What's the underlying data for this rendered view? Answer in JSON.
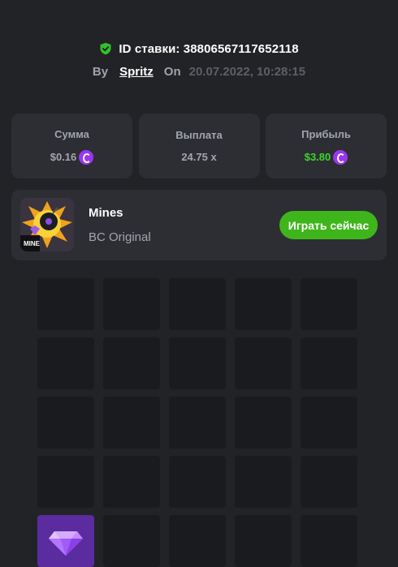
{
  "bet": {
    "id_text": "ID ставки: 3880656711765211​8",
    "by_label": "By",
    "username": "Spritz",
    "on_label": "On",
    "datetime": "20.07.2022, 10:28:15"
  },
  "stats": [
    {
      "label": "Сумма",
      "value": "$0.16",
      "color": "#a1a5ad"
    },
    {
      "label": "Выплата",
      "value": "24.75 x",
      "color": "#a1a5ad"
    },
    {
      "label": "Прибыль",
      "value": "$3.80",
      "color": "#3ed52c"
    }
  ],
  "game": {
    "title": "Mines",
    "subtitle": "BC Original",
    "thumb_badge": "MINE",
    "play_label": "Играть сейчас"
  },
  "grid": {
    "columns": 5,
    "rows_visible": 5,
    "revealed": [
      {
        "row": 4,
        "col": 1,
        "type": "gem"
      }
    ]
  },
  "icons": {
    "shield": "shield-check-icon",
    "coin": "bc-coin-icon",
    "gem": "diamond-icon"
  },
  "colors": {
    "accent_green": "#3fb51c",
    "coin_purple": "#9b35f0",
    "gem_tile": "#5a2ca0"
  }
}
